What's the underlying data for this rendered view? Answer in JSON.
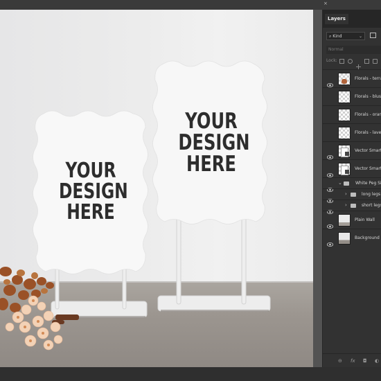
{
  "panel": {
    "tab_label": "Layers",
    "filter": {
      "kind_label": "Kind"
    },
    "blend_mode": "Normal",
    "lock_label": "Lock:",
    "layers": [
      {
        "name": "Florals - terracotta",
        "visible": true,
        "thumb": "checker",
        "type": "small"
      },
      {
        "name": "Florals - blush",
        "visible": false,
        "thumb": "checker"
      },
      {
        "name": "Florals - orange",
        "visible": false,
        "thumb": "checker"
      },
      {
        "name": "Florals - lavender",
        "visible": false,
        "thumb": "checker"
      },
      {
        "name": "Vector Smart Object",
        "visible": true,
        "thumb": "smart"
      },
      {
        "name": "Vector Smart Object",
        "visible": true,
        "thumb": "smart"
      },
      {
        "name": "White Peg Sign",
        "visible": true,
        "thumb": "group",
        "expanded": true
      },
      {
        "name": "long legs",
        "visible": true,
        "thumb": "folder"
      },
      {
        "name": "short legs",
        "visible": true,
        "thumb": "folder"
      },
      {
        "name": "Plain Wall",
        "visible": true,
        "thumb": "wall"
      },
      {
        "name": "Background",
        "visible": true,
        "thumb": "photo"
      }
    ]
  },
  "canvas": {
    "sign_left_text": [
      "YOUR",
      "DESIGN",
      "HERE"
    ],
    "sign_right_text": [
      "YOUR",
      "DESIGN",
      "HERE"
    ]
  },
  "colors": {
    "panel_bg": "#323232",
    "sign": "#f7f7f7",
    "text": "#2d2d2d",
    "floral_rust": "#a35a2c",
    "floral_peach": "#f1c8a6"
  }
}
